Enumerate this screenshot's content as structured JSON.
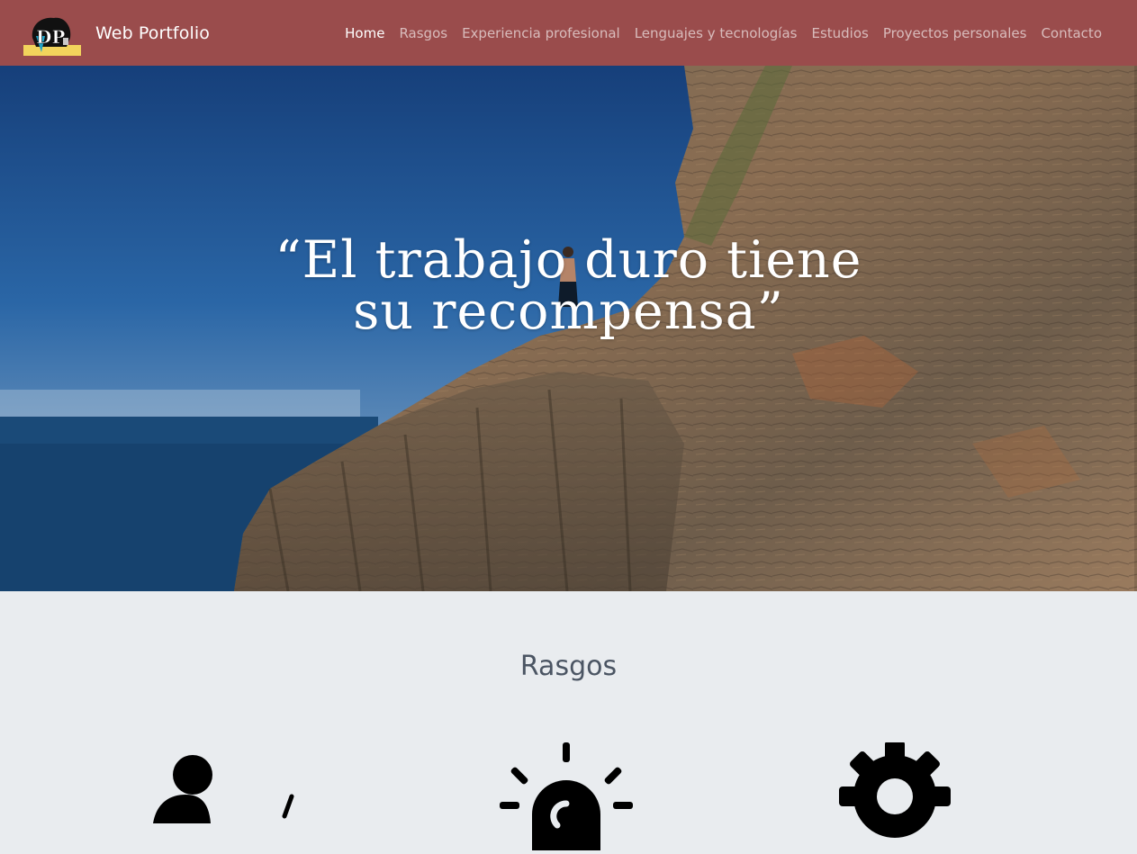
{
  "navbar": {
    "brand_title": "Web Portfolio",
    "logo_text": "DP",
    "background_color": "#9a4c4c",
    "links": [
      {
        "label": "Home",
        "active": true
      },
      {
        "label": "Rasgos",
        "active": false
      },
      {
        "label": "Experiencia profesional",
        "active": false
      },
      {
        "label": "Lenguajes y tecnologías",
        "active": false
      },
      {
        "label": "Estudios",
        "active": false
      },
      {
        "label": "Proyectos personales",
        "active": false
      },
      {
        "label": "Contacto",
        "active": false
      }
    ]
  },
  "hero": {
    "quote_line1": "“El trabajo duro tiene",
    "quote_line2": "su recompensa”"
  },
  "rasgos": {
    "title": "Rasgos",
    "icons": [
      "person-running-icon",
      "sun-rising-icon",
      "gear-icon"
    ]
  }
}
